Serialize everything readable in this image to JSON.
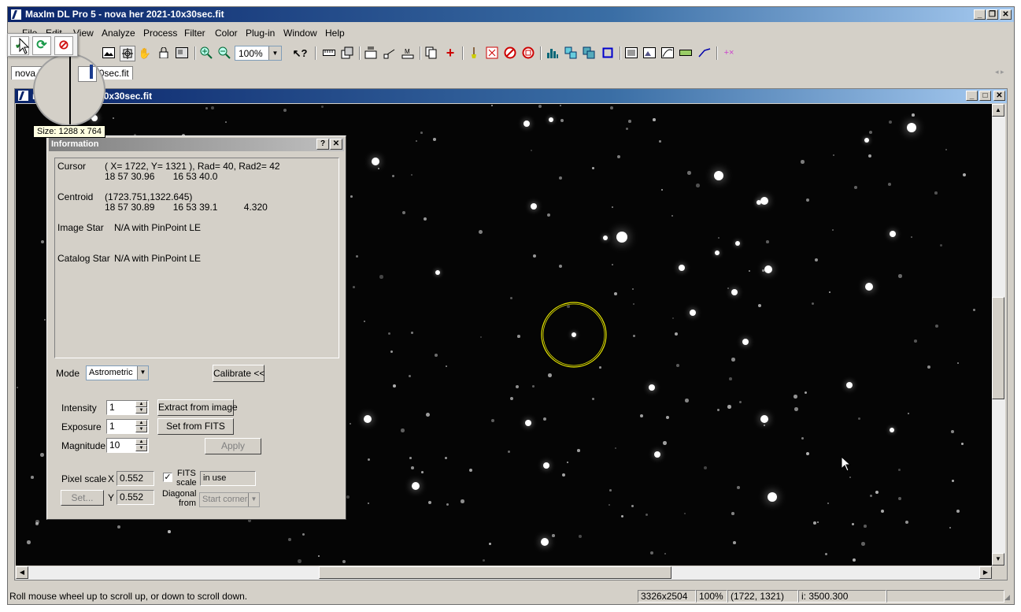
{
  "app": {
    "title": "MaxIm DL Pro 5 - nova her 2021-10x30sec.fit",
    "menu": [
      {
        "label": "File"
      },
      {
        "label": "Edit"
      },
      {
        "label": "View"
      },
      {
        "label": "Analyze"
      },
      {
        "label": "Process"
      },
      {
        "label": "Filter"
      },
      {
        "label": "Color"
      },
      {
        "label": "Plug-in"
      },
      {
        "label": "Window"
      },
      {
        "label": "Help"
      }
    ],
    "zoom": "100%",
    "tabs": [
      "nova her 2021-10x30sec.fit"
    ]
  },
  "document": {
    "title": "nova her 2021-10x30sec.fit",
    "size_tooltip": "Size: 1288 x 764"
  },
  "info_dialog": {
    "title": "Information",
    "help_label": "?",
    "close_label": "✕",
    "cursor_label": "Cursor",
    "cursor_line1": "( X= 1722, Y= 1321 ), Rad= 40, Rad2= 42",
    "cursor_line2": "18 57 30.96       16 53 40.0",
    "centroid_label": "Centroid",
    "centroid_line1": "(1723.751,1322.645)",
    "centroid_line2": "18 57 30.89       16 53 39.1          4.320",
    "image_star_label": "Image Star",
    "image_star_value": "N/A with PinPoint LE",
    "catalog_star_label": "Catalog Star",
    "catalog_star_value": "N/A with PinPoint LE",
    "mode_label": "Mode",
    "mode_value": "Astrometric",
    "calibrate_button": "Calibrate <<",
    "intensity_label": "Intensity",
    "intensity_value": "1",
    "exposure_label": "Exposure",
    "exposure_value": "1",
    "magnitude_label": "Magnitude",
    "magnitude_value": "10",
    "extract_button": "Extract from image",
    "set_fits_button": "Set from FITS",
    "apply_button": "Apply",
    "pixel_scale_label": "Pixel scale",
    "x_label": "X",
    "x_value": "0.552",
    "y_label": "Y",
    "y_value": "0.552",
    "set_button": "Set...",
    "fits_scale_label_1": "FITS",
    "fits_scale_label_2": "scale",
    "fits_scale_checked": true,
    "in_use_value": "in use",
    "diagonal_label_1": "Diagonal",
    "diagonal_label_2": "from",
    "start_corner_value": "Start corner"
  },
  "status_bar": {
    "hint": "Roll mouse wheel up to scroll up, or down to scroll down.",
    "dimensions": "3326x2504",
    "zoom": "100%",
    "coords": "(1722, 1321)",
    "intensity": "i:  3500.300"
  },
  "colors": {
    "title_gradient_start": "#0a246a",
    "aperture_circle": "#e6e600",
    "dialog_face": "#d4d0c8"
  }
}
